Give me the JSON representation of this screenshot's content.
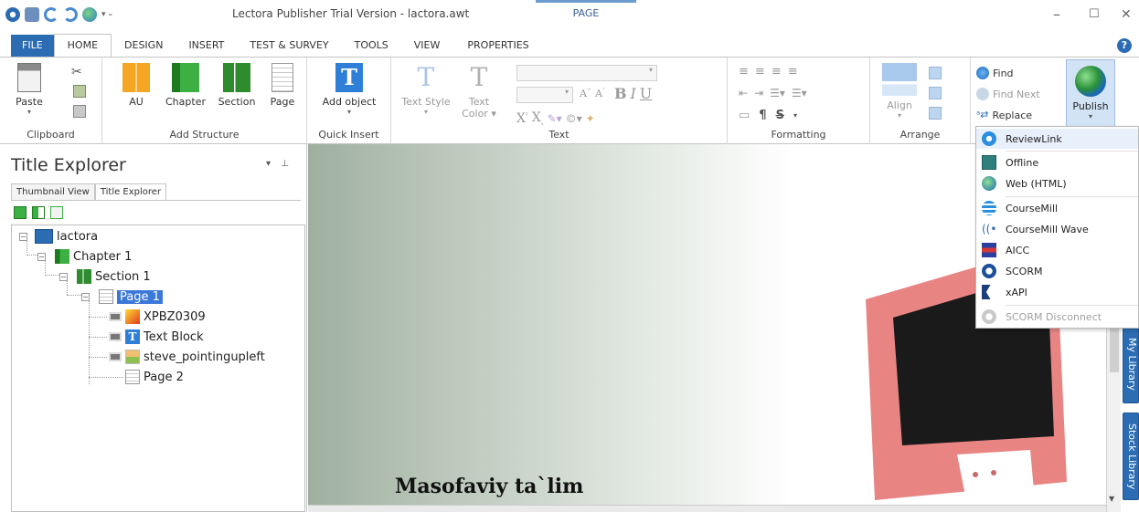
{
  "title_bar": {
    "app_title": "Lectora Publisher Trial Version - lactora.awt",
    "context_group": "PAGE"
  },
  "tabs": [
    {
      "label": "FILE"
    },
    {
      "label": "HOME"
    },
    {
      "label": "DESIGN"
    },
    {
      "label": "INSERT"
    },
    {
      "label": "TEST & SURVEY"
    },
    {
      "label": "TOOLS"
    },
    {
      "label": "VIEW"
    },
    {
      "label": "PROPERTIES"
    }
  ],
  "ribbon": {
    "clipboard": {
      "paste": "Paste",
      "label": "Clipboard"
    },
    "add_structure": {
      "au": "AU",
      "chapter": "Chapter",
      "section": "Section",
      "page": "Page",
      "label": "Add Structure"
    },
    "quick_insert": {
      "add_object": "Add object",
      "label": "Quick Insert"
    },
    "text": {
      "text_style": "Text Style",
      "text_color": "Text",
      "text_color2": "Color",
      "label": "Text"
    },
    "formatting": {
      "label": "Formatting"
    },
    "arrange": {
      "align": "Align",
      "label": "Arrange"
    },
    "find": {
      "find": "Find",
      "find_next": "Find Next",
      "replace": "Replace"
    },
    "publish": {
      "label": "Publish"
    }
  },
  "left_panel": {
    "title": "Title Explorer",
    "tabs": [
      "Thumbnail View",
      "Title Explorer"
    ],
    "tree": [
      {
        "label": "lactora"
      },
      {
        "label": "Chapter 1"
      },
      {
        "label": "Section 1"
      },
      {
        "label": "Page 1"
      },
      {
        "label": "XPBZ0309"
      },
      {
        "label": "Text Block"
      },
      {
        "label": "steve_pointingupleft"
      },
      {
        "label": "Page 2"
      }
    ]
  },
  "canvas": {
    "text": "Masofaviy ta`lim"
  },
  "side_tabs": [
    "My Library",
    "Stock Library"
  ],
  "publish_menu": [
    {
      "label": "ReviewLink",
      "icon": "reviewlink-icon"
    },
    {
      "label": "Offline",
      "icon": "offline-icon"
    },
    {
      "label": "Web (HTML)",
      "icon": "globe-icon"
    },
    {
      "label": "CourseMill",
      "icon": "coursemill-icon"
    },
    {
      "label": "CourseMill Wave",
      "icon": "wave-icon"
    },
    {
      "label": "AICC",
      "icon": "aicc-icon"
    },
    {
      "label": "SCORM",
      "icon": "scorm-icon"
    },
    {
      "label": "xAPI",
      "icon": "xapi-icon"
    },
    {
      "label": "SCORM Disconnect",
      "icon": "scorm-disconnect-icon"
    }
  ],
  "colors": {
    "accent": "#2b6cb3",
    "selection": "#3b78d8"
  }
}
